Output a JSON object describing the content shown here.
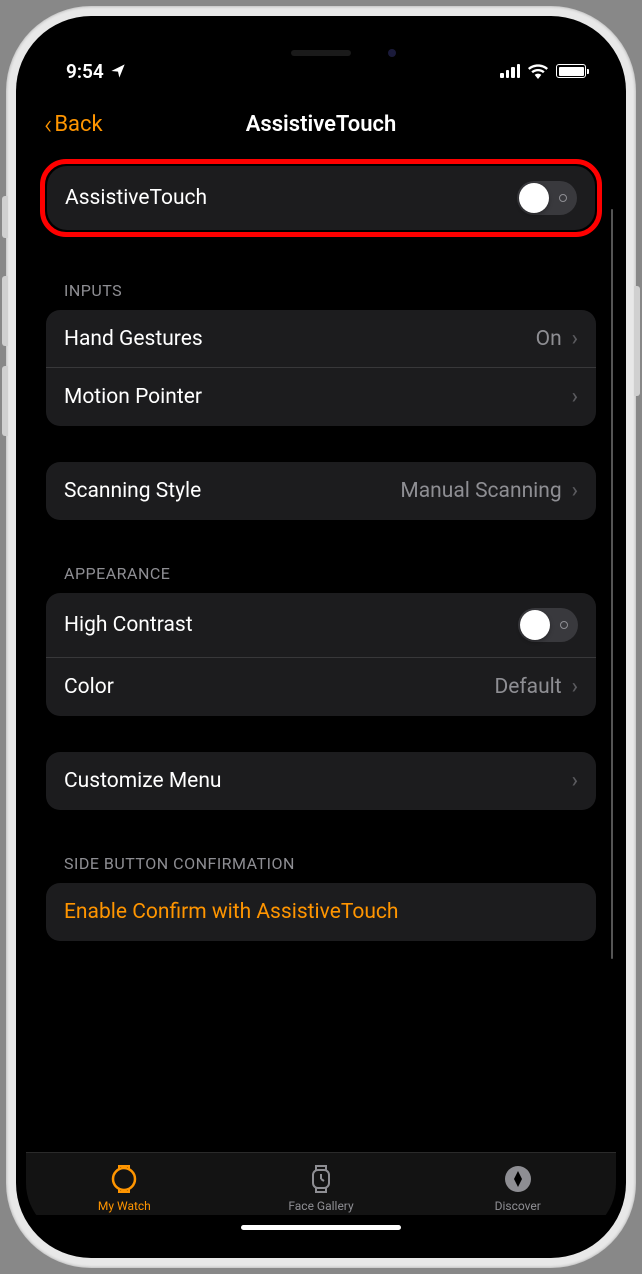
{
  "statusBar": {
    "time": "9:54",
    "locationIcon": "location"
  },
  "nav": {
    "backLabel": "Back",
    "title": "AssistiveTouch"
  },
  "mainToggle": {
    "label": "AssistiveTouch",
    "enabled": false
  },
  "sections": {
    "inputs": {
      "header": "INPUTS",
      "rows": [
        {
          "label": "Hand Gestures",
          "value": "On"
        },
        {
          "label": "Motion Pointer",
          "value": ""
        }
      ]
    },
    "scanning": {
      "rows": [
        {
          "label": "Scanning Style",
          "value": "Manual Scanning"
        }
      ]
    },
    "appearance": {
      "header": "APPEARANCE",
      "rows": [
        {
          "label": "High Contrast",
          "type": "toggle",
          "enabled": false
        },
        {
          "label": "Color",
          "value": "Default"
        }
      ]
    },
    "customize": {
      "rows": [
        {
          "label": "Customize Menu",
          "value": ""
        }
      ]
    },
    "sideButton": {
      "header": "SIDE BUTTON CONFIRMATION",
      "rows": [
        {
          "label": "Enable Confirm with AssistiveTouch"
        }
      ]
    }
  },
  "tabBar": {
    "items": [
      {
        "label": "My Watch",
        "active": true
      },
      {
        "label": "Face Gallery",
        "active": false
      },
      {
        "label": "Discover",
        "active": false
      }
    ]
  }
}
